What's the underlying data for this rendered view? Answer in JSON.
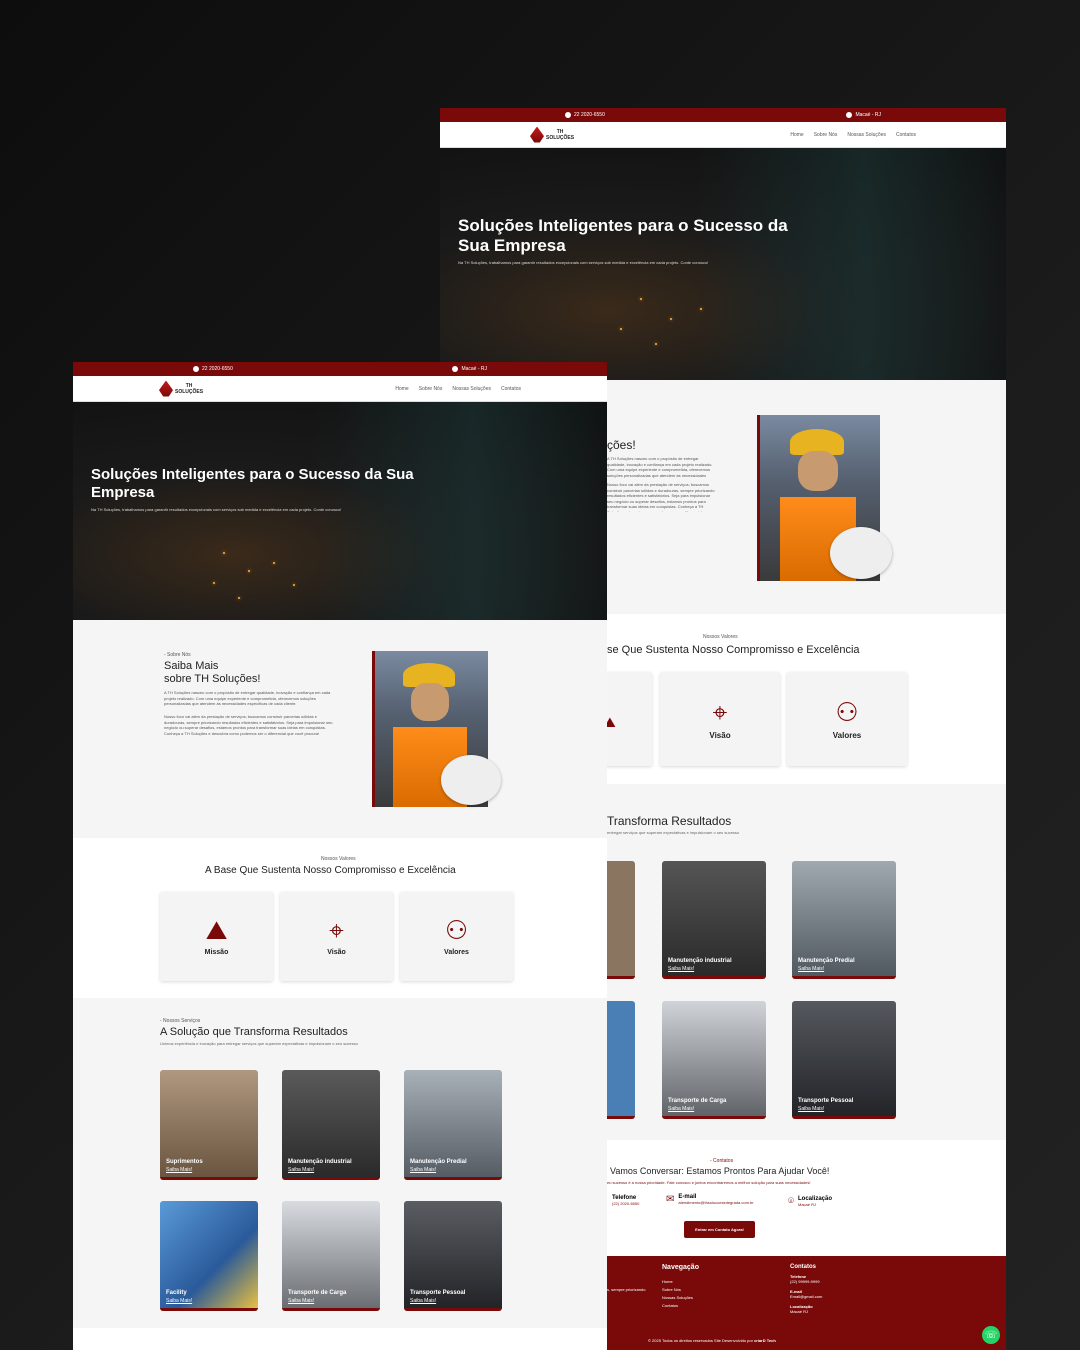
{
  "topbar": {
    "phone": "22 2020-6550",
    "location": "Macaé - RJ"
  },
  "logo": {
    "line1": "TH",
    "line2": "SOLUÇÕES"
  },
  "nav": [
    "Home",
    "Sobre Nós",
    "Nossas Soluções",
    "Contatos"
  ],
  "hero": {
    "title": "Soluções Inteligentes para o Sucesso da Sua Empresa",
    "subtitle": "Na TH Soluções, trabalhamos para garantir resultados excepcionais com serviços sob medida e excelência em cada projeto. Conte conosco!"
  },
  "about": {
    "kicker": "- Sobre Nós",
    "title1": "Saiba Mais",
    "title2": "sobre TH Soluções!",
    "title_partial": "ções!",
    "p1": "A TH Soluções nasceu com o propósito de entregar qualidade, inovação e confiança em cada projeto realizado. Com uma equipe experiente e comprometida, oferecemos soluções personalizadas que atendem às necessidades específicas de cada cliente.",
    "p2": "Nosso foco vai além da prestação de serviços; buscamos construir parcerias sólidas e duradouras, sempre priorizando resultados eficientes e satisfatórios. Seja para impulsionar seu negócio ou superar desafios, estamos prontos para transformar suas ideias em conquistas. Conheça a TH Soluções e descubra como podemos ser o diferencial que você procura!"
  },
  "values": {
    "kicker": "Nossos Valores",
    "title": "A Base Que Sustenta Nosso Compromisso e Excelência",
    "title_partial": "se Que Sustenta Nosso Compromisso e Excelência",
    "items": [
      {
        "label": "Missão",
        "icon": "mountain-flag-icon"
      },
      {
        "label": "Visão",
        "icon": "telescope-icon"
      },
      {
        "label": "Valores",
        "icon": "people-stars-icon"
      }
    ]
  },
  "services": {
    "kicker": "- Nossos Serviços",
    "title": "A Solução que Transforma Resultados",
    "title_partial": "Transforma Resultados",
    "subtitle": "Unimos experiência e inovação para entregar serviços que superam expectativas e impulsionam o seu sucesso",
    "subtitle_partial": "entregar serviços que superam expectativas e impulsionam o seu sucesso",
    "link": "Saiba Mais!",
    "items": [
      {
        "label": "Suprimentos",
        "color": "#8a7560"
      },
      {
        "label": "Manutenção industrial",
        "color": "#4a4a4a"
      },
      {
        "label": "Manutenção Predial",
        "color": "#8d96a0"
      },
      {
        "label": "Facility",
        "color": "#4a7fb5"
      },
      {
        "label": "Transporte de Carga",
        "color": "#b8bcc0"
      },
      {
        "label": "Transporte Pessoal",
        "color": "#3a3d42"
      }
    ]
  },
  "contact": {
    "kicker": "- Contatos",
    "title": "Vamos Conversar: Estamos Prontos Para Ajudar Você!",
    "subtitle": "eu sucesso é a nossa prioridade. Fale conosco e juntos encontraremos a melhor solução para suas necessidades!",
    "phone_label": "Telefone",
    "phone_value": "(22) 2020-6550",
    "email_label": "E-mail",
    "email_value": "atendimento@thsolucoesintegrada.com.br",
    "loc_label": "Localização",
    "loc_value": "Macaé RJ",
    "button": "Entrar em Contato Agora!"
  },
  "footer": {
    "left_text": "s, sempre priorizando",
    "nav_title": "Navegação",
    "nav_items": [
      "Home",
      "Sobre Nós",
      "Nossas Soluções",
      "Contatos"
    ],
    "contacts_title": "Contatos",
    "tel_label": "Telefone",
    "tel_value": "(22) 99999-9999",
    "email_label": "E-mail",
    "email_value": "Email@gmail.com",
    "loc_label": "Localização",
    "loc_value": "Macaé RJ",
    "copyright": "© 2025 Todos os direitos reservados Site Desenvolvido por",
    "dev": "criarD Tech"
  },
  "colors": {
    "brand": "#7a0a0a",
    "background": "#111111"
  }
}
